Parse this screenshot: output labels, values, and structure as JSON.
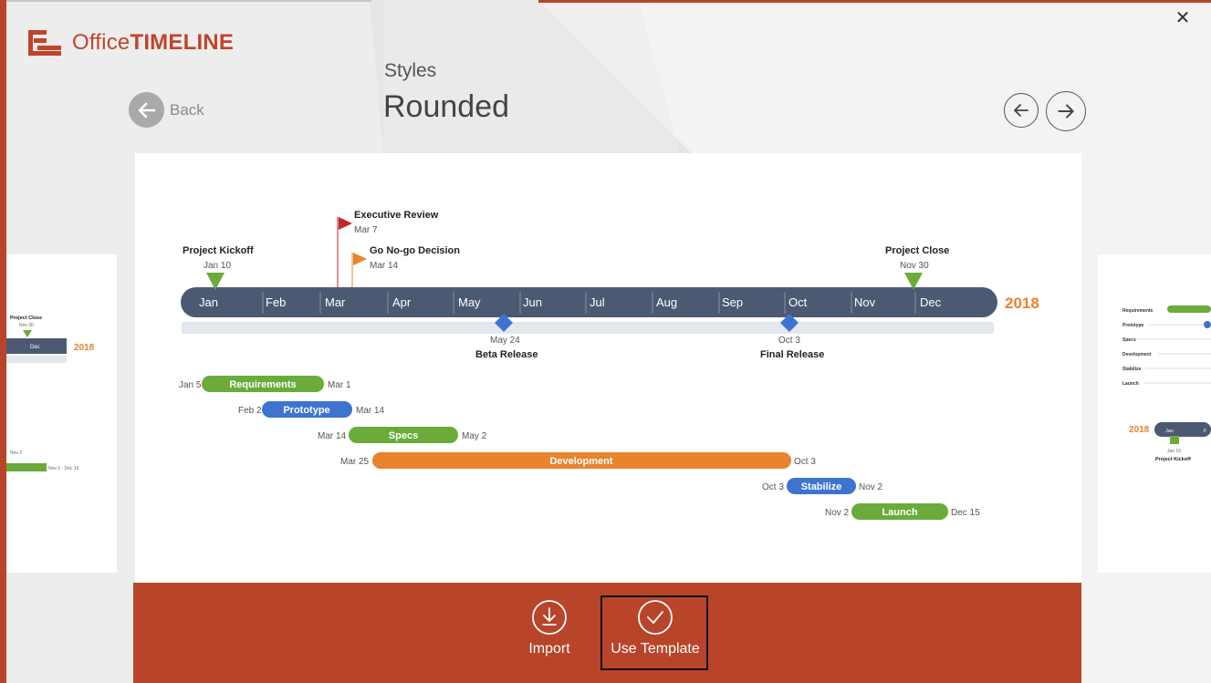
{
  "app": {
    "logo": {
      "office": "Office",
      "timeline": "TIMELINE"
    },
    "close_glyph": "✕"
  },
  "header": {
    "back_label": "Back",
    "section_label": "Styles",
    "style_name": "Rounded"
  },
  "timeline": {
    "year": "2018",
    "months": [
      "Jan",
      "Feb",
      "Mar",
      "Apr",
      "May",
      "Jun",
      "Jul",
      "Aug",
      "Sep",
      "Oct",
      "Nov",
      "Dec"
    ],
    "milestones": [
      {
        "name": "Project Kickoff",
        "date": "Jan 10",
        "shape": "triangle-down",
        "color": "#6aab3c"
      },
      {
        "name": "Executive Review",
        "date": "Mar 7",
        "shape": "flag",
        "color": "#c0282d"
      },
      {
        "name": "Go No-go Decision",
        "date": "Mar 14",
        "shape": "flag",
        "color": "#e8832e"
      },
      {
        "name": "Project Close",
        "date": "Nov 30",
        "shape": "triangle-down",
        "color": "#6aab3c"
      },
      {
        "name": "Beta Release",
        "date": "May 24",
        "shape": "diamond",
        "color": "#3e74d0"
      },
      {
        "name": "Final Release",
        "date": "Oct 3",
        "shape": "diamond",
        "color": "#3e74d0"
      }
    ],
    "tasks": [
      {
        "name": "Requirements",
        "start": "Jan 5",
        "end": "Mar 1",
        "color": "#6aab3c"
      },
      {
        "name": "Prototype",
        "start": "Feb 2",
        "end": "Mar 14",
        "color": "#3e74d0"
      },
      {
        "name": "Specs",
        "start": "Mar 14",
        "end": "May 2",
        "color": "#6aab3c"
      },
      {
        "name": "Development",
        "start": "Mar 25",
        "end": "Oct 3",
        "color": "#e8832e"
      },
      {
        "name": "Stabilize",
        "start": "Oct 3",
        "end": "Nov 2",
        "color": "#3e74d0"
      },
      {
        "name": "Launch",
        "start": "Nov 2",
        "end": "Dec 15",
        "color": "#6aab3c"
      }
    ]
  },
  "left_thumb": {
    "milestone": "Project Close",
    "milestone_date": "Nov 30",
    "month": "Dec",
    "year": "2018",
    "task_start": "Nov 2",
    "task_range": "Nov 2 - Dec 15"
  },
  "right_thumb": {
    "tasks": [
      "Requirements",
      "Prototype",
      "Specs",
      "Development",
      "Stabilize",
      "Launch"
    ],
    "year": "2018",
    "month": "Jan",
    "month2": "F",
    "milestone_date": "Jan 10",
    "milestone": "Project Kickoff"
  },
  "actions": {
    "import_label": "Import",
    "use_template_label": "Use Template"
  },
  "colors": {
    "accent": "#b8452a",
    "axis": "#4b5a72",
    "green": "#6aab3c",
    "blue": "#3e74d0",
    "orange": "#e8832e",
    "year": "#e8832e"
  }
}
